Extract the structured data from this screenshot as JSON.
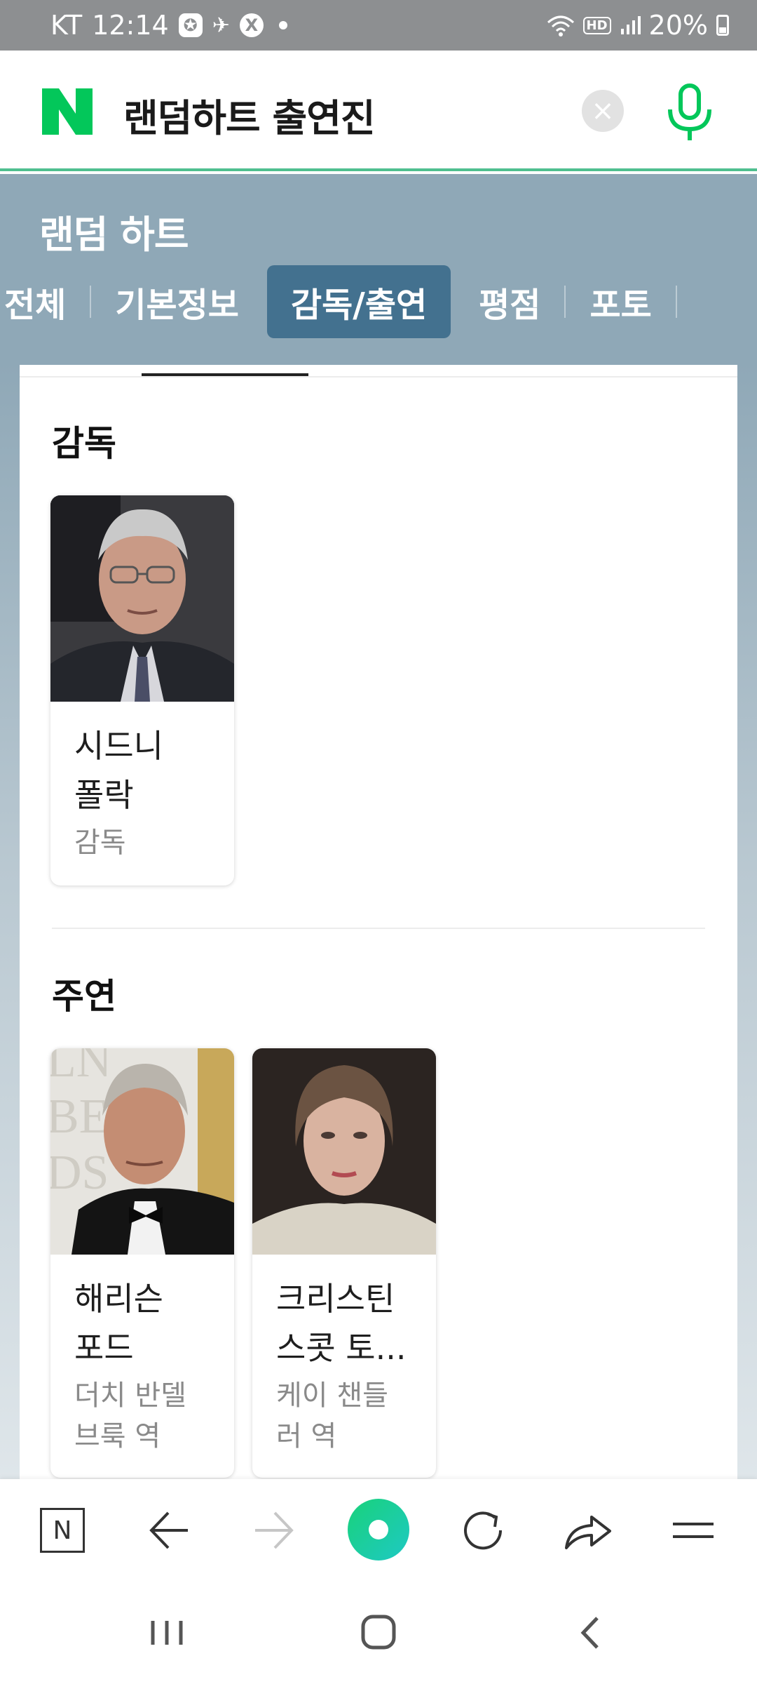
{
  "status_bar": {
    "carrier": "KT",
    "time": "12:14",
    "notification_icons": [
      "compass-icon",
      "satellite-icon",
      "x-app-icon"
    ],
    "hd_label": "HD",
    "battery": "20%"
  },
  "search": {
    "query": "랜덤하트 출연진",
    "logo_letter": "N"
  },
  "movie": {
    "title": "랜덤 하트",
    "tabs": [
      {
        "label": "전체",
        "active": false
      },
      {
        "label": "기본정보",
        "active": false
      },
      {
        "label": "감독/출연",
        "active": true
      },
      {
        "label": "평점",
        "active": false
      },
      {
        "label": "포토",
        "active": false
      }
    ]
  },
  "sections": {
    "director": {
      "title": "감독",
      "people": [
        {
          "name_line1": "시드니",
          "name_line2": "폴락",
          "role_line1": "감독",
          "role_line2": ""
        }
      ]
    },
    "lead": {
      "title": "주연",
      "people": [
        {
          "name_line1": "해리슨",
          "name_line2": "포드",
          "role_line1": "더치 반델",
          "role_line2": "브룩 역"
        },
        {
          "name_line1": "크리스틴",
          "name_line2": "스콧 토...",
          "role_line1": "케이 챈들",
          "role_line2": "러 역"
        }
      ]
    }
  },
  "browser_toolbar": {
    "icons": [
      "naver-home-icon",
      "back-arrow-icon",
      "forward-arrow-icon",
      "green-dot-icon",
      "refresh-icon",
      "share-icon",
      "menu-icon"
    ],
    "home_letter": "N"
  },
  "colors": {
    "naver_green": "#03c75a",
    "band": "#8fa8b7",
    "active_tab": "#43718f"
  }
}
